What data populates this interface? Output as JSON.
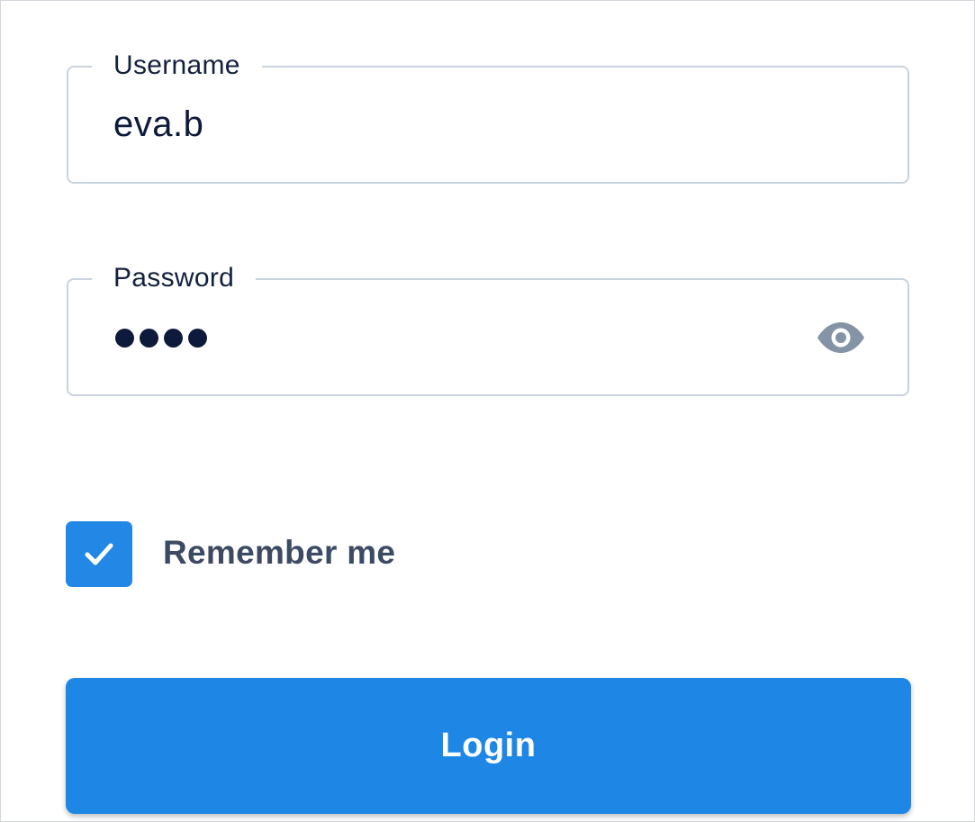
{
  "username": {
    "label": "Username",
    "value": "eva.b"
  },
  "password": {
    "label": "Password",
    "masked_length": 4,
    "toggle_icon": "eye-icon"
  },
  "remember": {
    "label": "Remember me",
    "checked": true,
    "check_icon": "check-icon"
  },
  "login": {
    "label": "Login"
  },
  "colors": {
    "accent": "#1e87e6",
    "border": "#c9d2de",
    "text_dark": "#0e1a3b",
    "label_text": "#3c4a63"
  }
}
